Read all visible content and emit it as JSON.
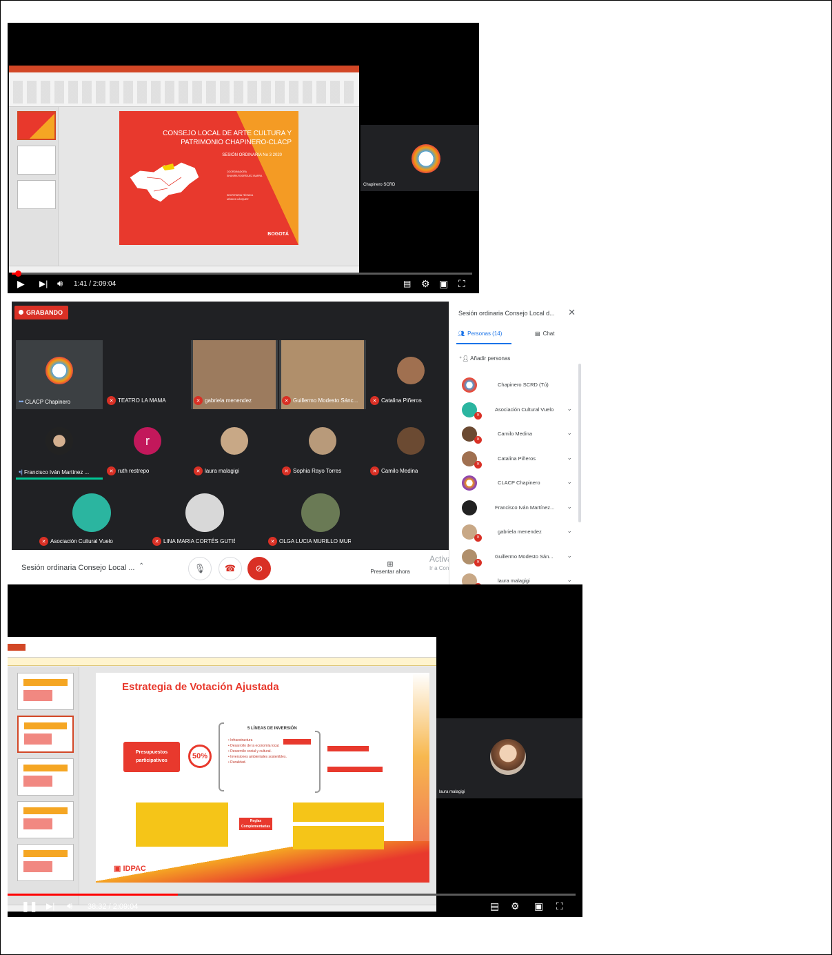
{
  "player1": {
    "time": "1:41 / 2:09:04",
    "progress": 0.013,
    "slide": {
      "title": "CONSEJO LOCAL DE ARTE CULTURA Y PATRIMONIO CHAPINERO-CLACP",
      "subtitle": "SESIÓN ORDINARIA No 3 2020",
      "coordination": "COORDINADORA",
      "coordinator": "SHANIRA RODRÍGUEZ IBARRA",
      "secretary_label": "SECRETARIA TÉCNICA",
      "secretary": "MÓNICA VÁSQUEZ",
      "logo": "BOGOTÁ"
    },
    "side_tile_name": "Chapinero SCRD"
  },
  "meet": {
    "recording_label": "GRABANDO",
    "tiles": [
      {
        "name": "CLACP Chapinero",
        "muted": false
      },
      {
        "name": "TEATRO LA MAMA",
        "muted": true
      },
      {
        "name": "gabriela menendez",
        "muted": true
      },
      {
        "name": "Guillermo Modesto Sánc...",
        "muted": true
      },
      {
        "name": "Catalina Piñeros",
        "muted": true
      },
      {
        "name": "Francisco Iván Martínez ...",
        "muted": false
      },
      {
        "name": "ruth restrepo",
        "muted": true,
        "initial": "r"
      },
      {
        "name": "laura malagigi",
        "muted": true
      },
      {
        "name": "Sophia Rayo Torres",
        "muted": true
      },
      {
        "name": "Camilo Medina",
        "muted": true
      },
      {
        "name": "Asociación Cultural Vuelo",
        "muted": true
      },
      {
        "name": "LINA MARIA CORTÉS GUTIÉRREZ",
        "muted": true
      },
      {
        "name": "OLGA LUCIA MURILLO MURCIA",
        "muted": true
      }
    ],
    "meeting_title": "Sesión ordinaria Consejo Local ...",
    "present_label": "Presentar ahora",
    "activate_windows": "Activar Windows",
    "activate_windows_sub": "Ir a Configuración de PC para activar Windows.",
    "panel": {
      "title": "Sesión ordinaria Consejo Local d...",
      "people_tab": "Personas (14)",
      "chat_tab": "Chat",
      "add_people": "Añadir personas",
      "participants": [
        {
          "name": "Chapinero SCRD (Tú)",
          "muted": false
        },
        {
          "name": "Asociación Cultural Vuelo",
          "muted": true
        },
        {
          "name": "Camilo Medina",
          "muted": true
        },
        {
          "name": "Catalina Piñeros",
          "muted": true
        },
        {
          "name": "CLACP Chapinero",
          "muted": false
        },
        {
          "name": "Francisco Iván Martínez...",
          "muted": false
        },
        {
          "name": "gabriela menendez",
          "muted": true
        },
        {
          "name": "Guillermo Modesto Sán...",
          "muted": true
        },
        {
          "name": "laura malagigi",
          "muted": true
        }
      ]
    }
  },
  "player2": {
    "time": "38:32 / 2:09:04",
    "progress": 0.3,
    "slide": {
      "title": "Estrategia de Votación Ajustada",
      "left_box": "Presupuestos participativos",
      "percent": "50%",
      "lineas_title": "5 LÍNEAS DE INVERSIÓN",
      "bullets": [
        "• Infraestructura",
        "• Desarrollo de la economía local.",
        "• Desarrollo social y cultural.",
        "• Inversiones ambientales sostenibles.",
        "• Ruralidad."
      ],
      "middle_box": "Reglas Complementarias",
      "logo": "IDPAC"
    },
    "side_tile_name": "laura malagigi"
  },
  "colors": {
    "youtube_red": "#ff0000",
    "meet_red": "#d93025",
    "meet_blue": "#1a73e8",
    "ppt_orange": "#d24726"
  }
}
